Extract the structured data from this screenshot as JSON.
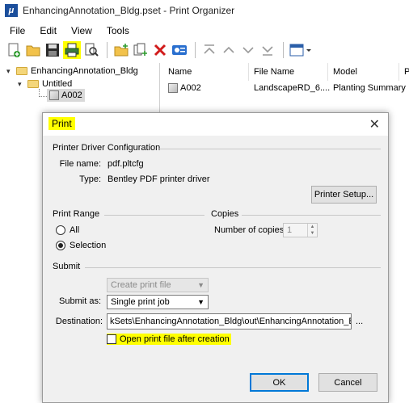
{
  "window": {
    "title": "EnhancingAnnotation_Bldg.pset - Print Organizer"
  },
  "menu": [
    "File",
    "Edit",
    "View",
    "Tools"
  ],
  "toolbar_icons": [
    "new-icon",
    "open-folder-icon",
    "save-icon",
    "print-icon",
    "print-preview-icon",
    "new-folder-icon",
    "add-sheets-icon",
    "delete-icon",
    "properties-icon",
    "move-top-icon",
    "move-up-icon",
    "move-down-icon",
    "move-bottom-icon",
    "display-options-icon"
  ],
  "tree": {
    "root": "EnhancingAnnotation_Bldg",
    "folder": "Untitled",
    "item": "A002"
  },
  "list": {
    "columns": [
      "Name",
      "File Name",
      "Model",
      "P"
    ],
    "rows": [
      {
        "name": "A002",
        "file": "LandscapeRD_6....",
        "model": "Planting Summary"
      }
    ]
  },
  "dialog": {
    "title": "Print",
    "printer_driver_group": "Printer Driver Configuration",
    "file_name_label": "File name:",
    "file_name_value": "pdf.pltcfg",
    "type_label": "Type:",
    "type_value": "Bentley PDF printer driver",
    "printer_setup_button": "Printer Setup...",
    "print_range_group": "Print Range",
    "all_label": "All",
    "selection_label": "Selection",
    "copies_group": "Copies",
    "copies_label": "Number of copies:",
    "copies_value": "1",
    "submit_group": "Submit",
    "create_print_file": "Create print file",
    "submit_as_label": "Submit as:",
    "submit_as_value": "Single print job",
    "destination_label": "Destination:",
    "destination_value": "kSets\\EnhancingAnnotation_Bldg\\out\\EnhancingAnnotation_Bldg.pdf",
    "browse_button": "...",
    "open_after_label": "Open print file after creation",
    "ok_button": "OK",
    "cancel_button": "Cancel",
    "close_glyph": "✕"
  }
}
